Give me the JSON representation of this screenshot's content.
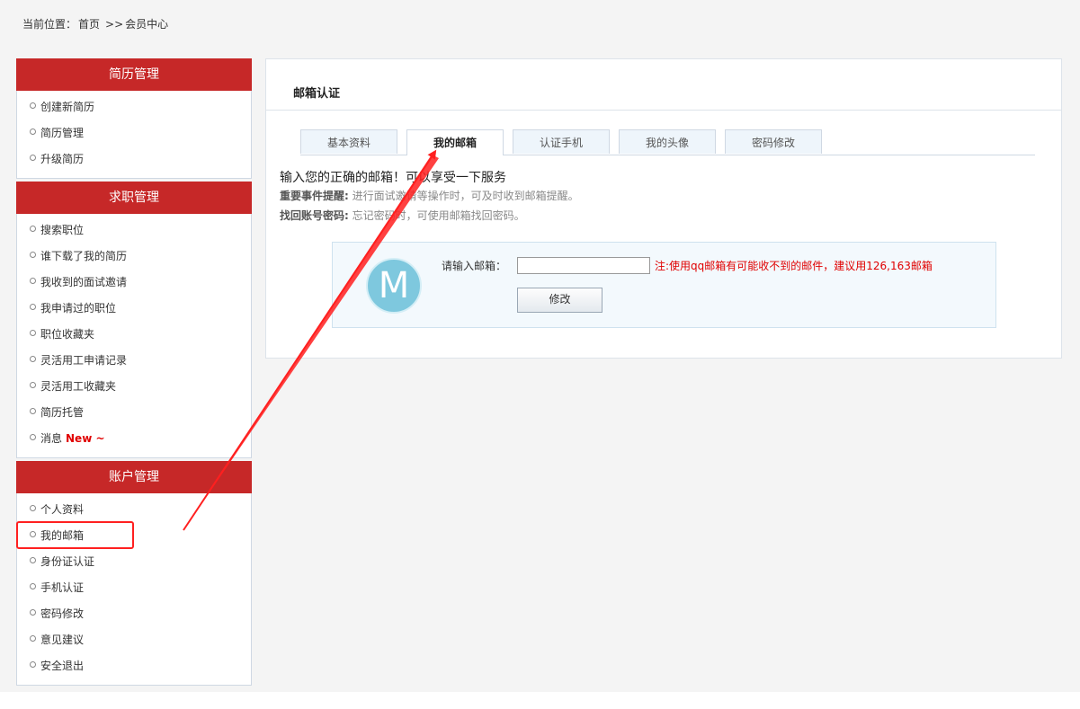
{
  "breadcrumb": {
    "label": "当前位置：",
    "home": "首页",
    "separator": ">>",
    "current": "会员中心"
  },
  "sidebar": {
    "groups": [
      {
        "title": "简历管理",
        "items": [
          "创建新简历",
          "简历管理",
          "升级简历"
        ]
      },
      {
        "title": "求职管理",
        "items": [
          "搜索职位",
          "谁下载了我的简历",
          "我收到的面试邀请",
          "我申请过的职位",
          "职位收藏夹",
          "灵活用工申请记录",
          "灵活用工收藏夹",
          "简历托管",
          "消息"
        ],
        "new_tag": "New ~"
      },
      {
        "title": "账户管理",
        "items": [
          "个人资料",
          "我的邮箱",
          "身份证认证",
          "手机认证",
          "密码修改",
          "意见建议",
          "安全退出"
        ]
      }
    ]
  },
  "main": {
    "title": "邮箱认证",
    "tabs": [
      "基本资料",
      "我的邮箱",
      "认证手机",
      "我的头像",
      "密码修改"
    ],
    "active_tab": 1,
    "intro_heading": "输入您的正确的邮箱！可以享受一下服务",
    "reminder_label": "重要事件提醒:",
    "reminder_text": "进行面试邀请等操作时，可及时收到邮箱提醒。",
    "recover_label": "找回账号密码:",
    "recover_text": "忘记密码时，可使用邮箱找回密码。",
    "avatar_letter": "M",
    "email_label": "请输入邮箱：",
    "email_value": "",
    "email_note": "注:使用qq邮箱有可能收不到的邮件，建议用126,163邮箱",
    "submit_label": "修改"
  },
  "colors": {
    "header_red": "#c62828",
    "annotation_red": "#ff2020",
    "note_red": "#e00000",
    "avatar_blue": "#7ec8de"
  }
}
